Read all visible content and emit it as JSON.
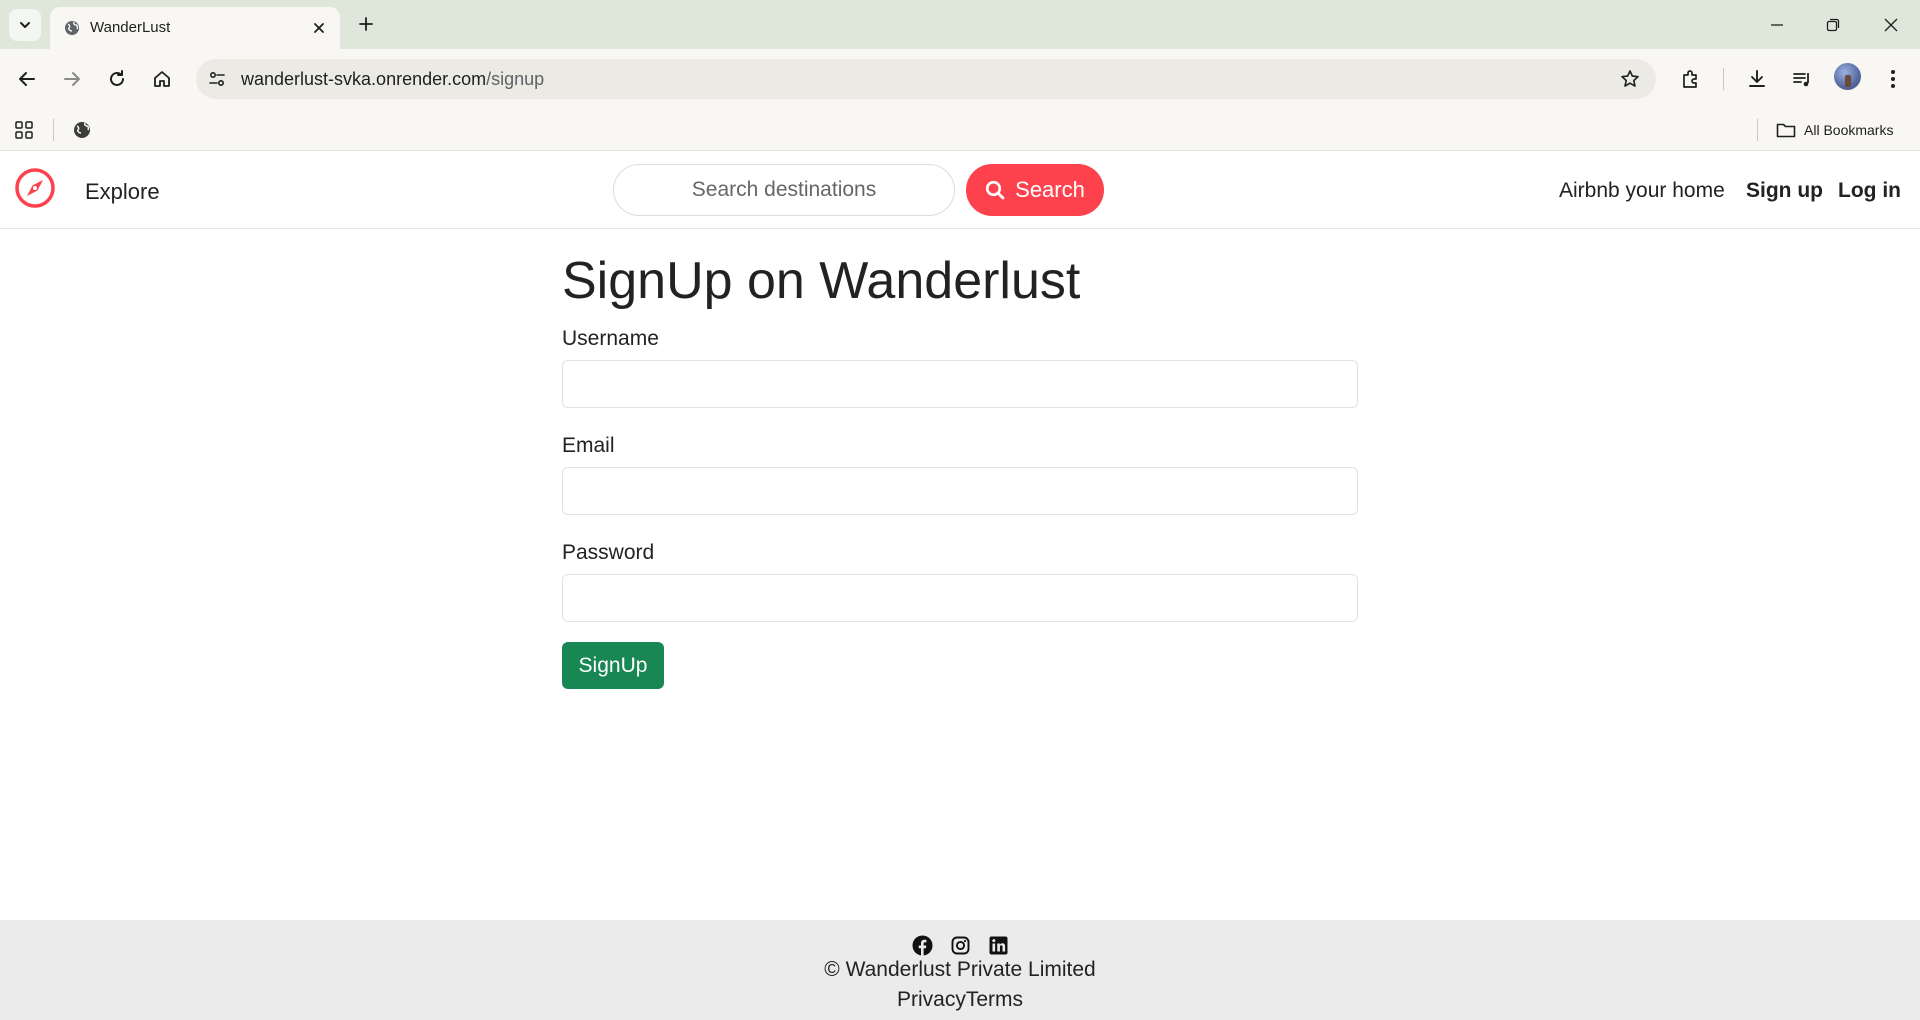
{
  "browser": {
    "tab_title": "WanderLust",
    "url_host": "wanderlust-svka.onrender.com",
    "url_path": "/signup",
    "bookmarks_label": "All Bookmarks"
  },
  "navbar": {
    "explore_label": "Explore",
    "search_placeholder": "Search destinations",
    "search_button_label": "Search",
    "host_link": "Airbnb your home",
    "signup_link": "Sign up",
    "login_link": "Log in"
  },
  "form": {
    "title": "SignUp on Wanderlust",
    "username_label": "Username",
    "username_value": "",
    "email_label": "Email",
    "email_value": "",
    "password_label": "Password",
    "password_value": "",
    "submit_label": "SignUp"
  },
  "footer": {
    "copyright": "© Wanderlust Private Limited",
    "privacy_link": "Privacy",
    "terms_link": "Terms",
    "social_icons": [
      "facebook-icon",
      "instagram-icon",
      "linkedin-icon"
    ]
  },
  "colors": {
    "brand": "#fe424d",
    "submit": "#198754",
    "footer_bg": "#ebebeb"
  }
}
